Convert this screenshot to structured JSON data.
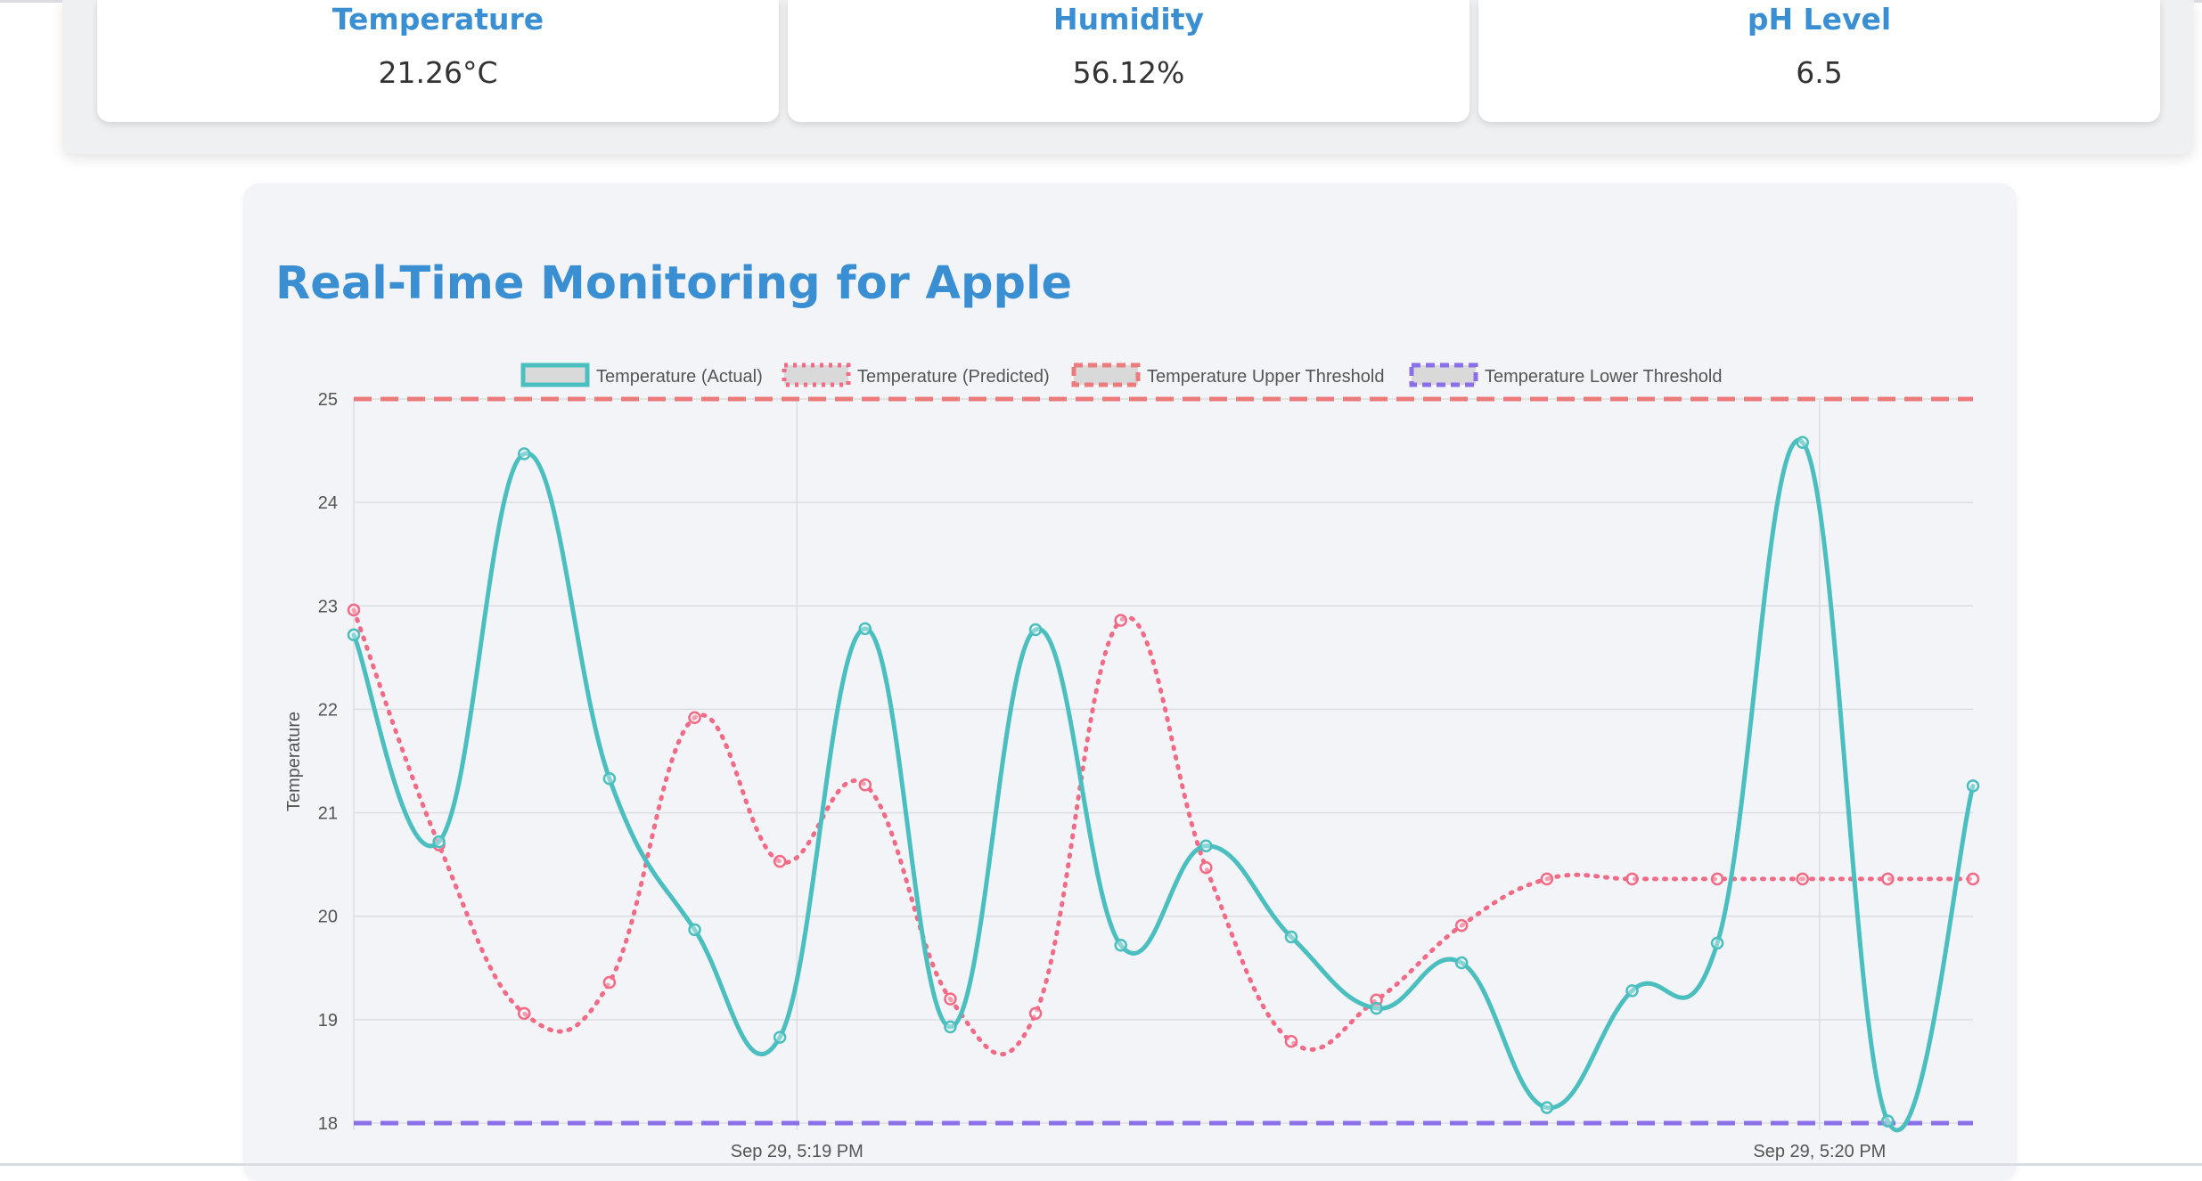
{
  "sensors": [
    {
      "title": "Temperature",
      "value": "21.26°C"
    },
    {
      "title": "Humidity",
      "value": "56.12%"
    },
    {
      "title": "pH Level",
      "value": "6.5"
    }
  ],
  "chart_heading": "Real-Time Monitoring for Apple",
  "colors": {
    "actual": "#4bbfbf",
    "predicted": "#f26b86",
    "upper": "#ee7b7b",
    "lower": "#8b6fe8",
    "grid": "#dcdde2",
    "tick_text": "#555555",
    "heading": "#3a8fd3"
  },
  "chart_data": {
    "type": "line",
    "ylabel": "Temperature",
    "ylim": [
      18,
      25
    ],
    "yticks": [
      18,
      19,
      20,
      21,
      22,
      23,
      24,
      25
    ],
    "x_tick_labels": [
      "Sep 29, 5:19 PM",
      "Sep 29, 5:20 PM"
    ],
    "x_tick_index": [
      5.2,
      17.2
    ],
    "grid": true,
    "legend_position": "top",
    "series": [
      {
        "name": "Temperature (Actual)",
        "style": "solid",
        "markers": true,
        "values": [
          22.72,
          20.72,
          24.47,
          21.33,
          19.87,
          18.83,
          22.78,
          18.93,
          22.77,
          19.72,
          20.68,
          19.8,
          19.11,
          19.55,
          18.15,
          19.28,
          19.74,
          24.58,
          18.02,
          21.26
        ]
      },
      {
        "name": "Temperature (Predicted)",
        "style": "dotted",
        "markers": true,
        "values": [
          22.96,
          20.69,
          19.06,
          19.36,
          21.92,
          20.53,
          21.27,
          19.2,
          19.06,
          22.86,
          20.47,
          18.79,
          19.19,
          19.91,
          20.36,
          20.36,
          20.36,
          20.36,
          20.36,
          20.36
        ]
      },
      {
        "name": "Temperature Upper Threshold",
        "style": "dashed",
        "markers": false,
        "values": [
          25,
          25
        ]
      },
      {
        "name": "Temperature Lower Threshold",
        "style": "dashed",
        "markers": false,
        "values": [
          18,
          18
        ]
      }
    ]
  }
}
